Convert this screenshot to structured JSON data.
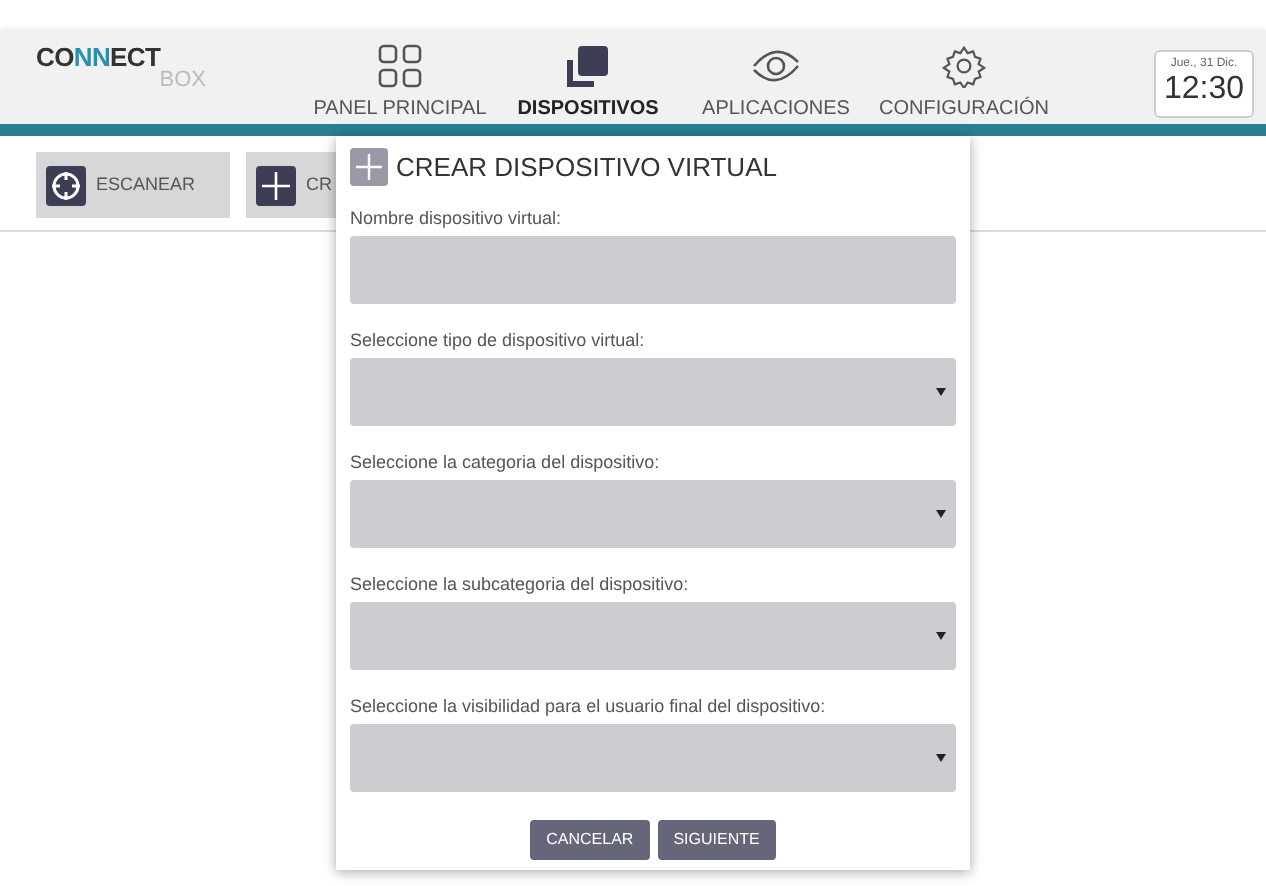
{
  "logo": {
    "title": "CONNECT",
    "subtitle": "BOX"
  },
  "nav": [
    {
      "label": "PANEL PRINCIPAL",
      "kind": "grid",
      "selected": false
    },
    {
      "label": "DISPOSITIVOS",
      "kind": "devices",
      "selected": true
    },
    {
      "label": "APLICACIONES",
      "kind": "apps",
      "selected": false
    },
    {
      "label": "CONFIGURACIÓN",
      "kind": "gear",
      "selected": false
    }
  ],
  "clock": {
    "date": "Jue., 31 Dic.",
    "time": "12:30"
  },
  "toolbar": [
    {
      "label": "ESCANEAR",
      "kind": "scan"
    },
    {
      "label": "CR",
      "kind": "plus"
    }
  ],
  "dialog": {
    "title": "CREAR DISPOSITIVO VIRTUAL",
    "fields": [
      {
        "label": "Nombre dispositivo virtual:",
        "kind": "text"
      },
      {
        "label": "Seleccione tipo de dispositivo virtual:",
        "kind": "select"
      },
      {
        "label": "Seleccione la categoria del dispositivo:",
        "kind": "select"
      },
      {
        "label": "Seleccione la subcategoria del dispositivo:",
        "kind": "select"
      },
      {
        "label": "Seleccione la visibilidad para el usuario final del dispositivo:",
        "kind": "select"
      }
    ],
    "buttons": [
      "CANCELAR",
      "SIGUIENTE"
    ]
  }
}
